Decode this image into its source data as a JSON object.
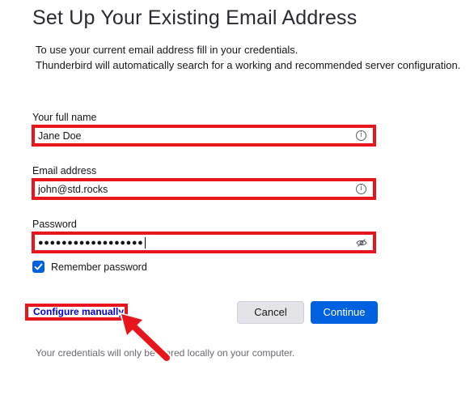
{
  "header": {
    "title": "Set Up Your Existing Email Address",
    "intro_line1": "To use your current email address fill in your credentials.",
    "intro_line2": "Thunderbird will automatically search for a working and recommended server configuration."
  },
  "form": {
    "full_name": {
      "label": "Your full name",
      "value": "Jane Doe",
      "icon": "info-icon"
    },
    "email": {
      "label": "Email address",
      "value": "john@std.rocks",
      "icon": "info-icon"
    },
    "password": {
      "label": "Password",
      "value": "●●●●●●●●●●●●●●●●●●",
      "icon": "eye-slash-icon"
    },
    "remember": {
      "label": "Remember password",
      "checked": true
    }
  },
  "actions": {
    "configure_manually": "Configure manually",
    "cancel": "Cancel",
    "continue": "Continue"
  },
  "footnote": "Your credentials will only be stored locally on your computer.",
  "colors": {
    "accent": "#0061e0",
    "highlight": "#e8161c",
    "link": "#0000cc"
  }
}
